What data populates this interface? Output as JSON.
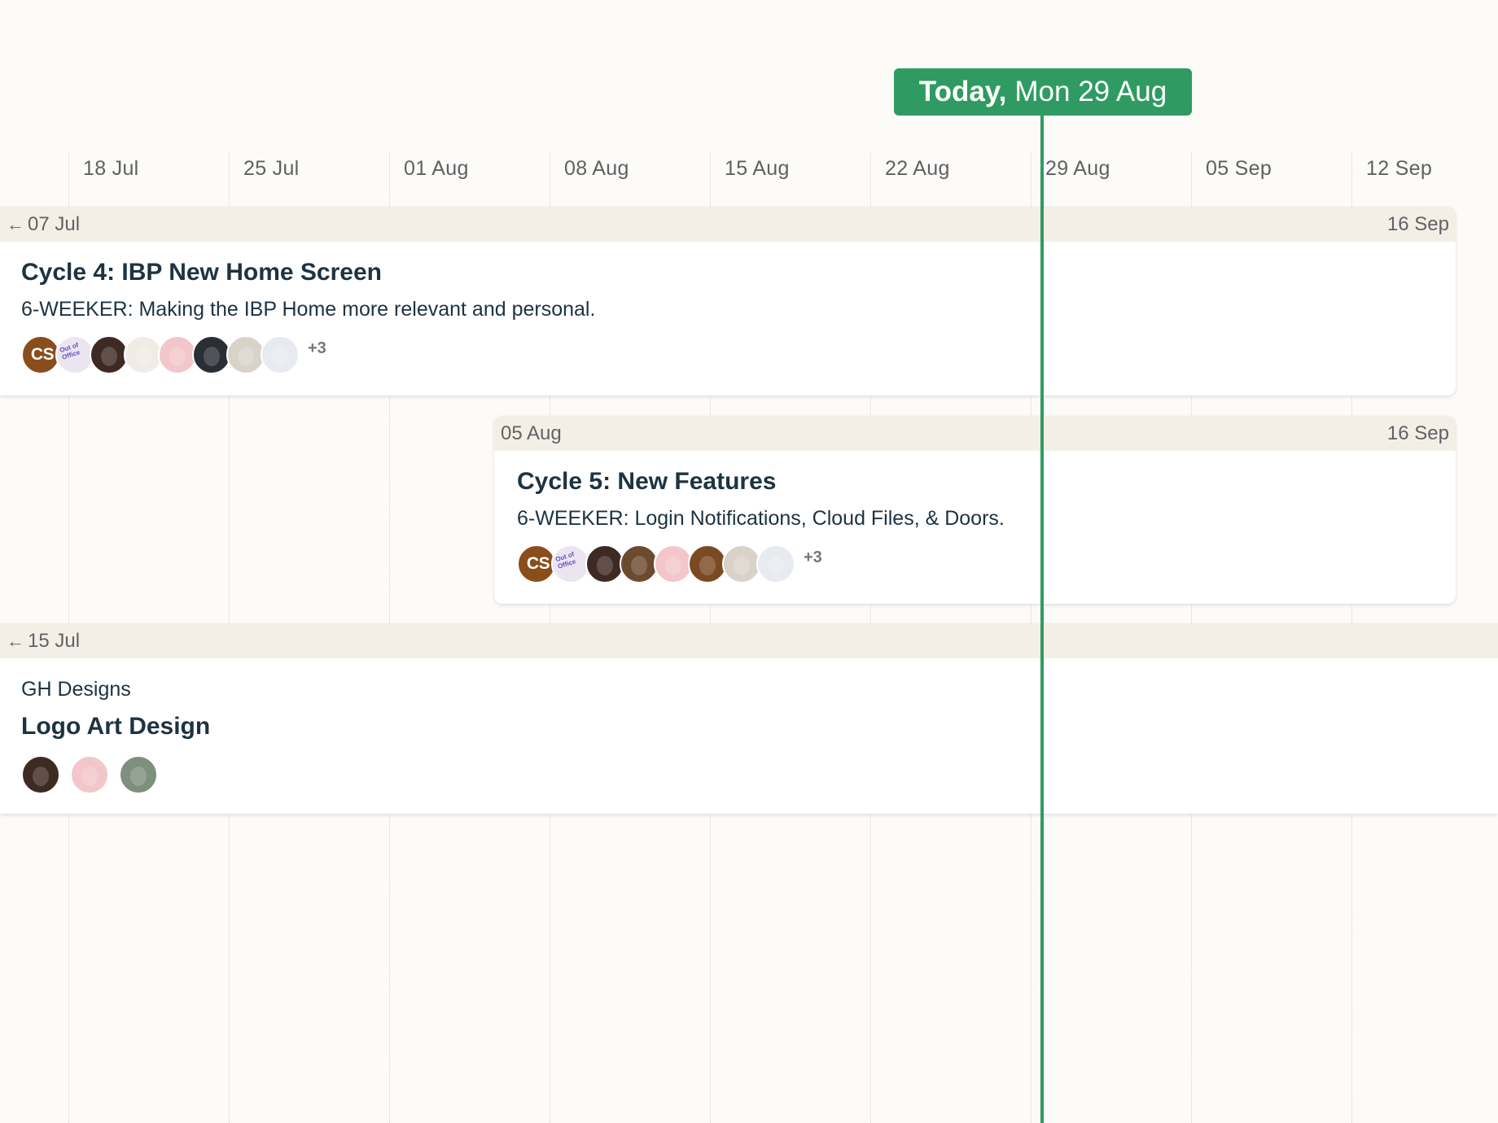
{
  "today": {
    "label": "Today,",
    "date": "Mon 29 Aug"
  },
  "weeks": [
    "18 Jul",
    "25 Jul",
    "01 Aug",
    "08 Aug",
    "15 Aug",
    "22 Aug",
    "29 Aug",
    "05 Sep",
    "12 Sep"
  ],
  "projects": [
    {
      "start": "07 Jul",
      "end": "16 Sep",
      "title": "Cycle 4: IBP New Home Screen",
      "description": "6-WEEKER: Making the IBP Home more relevant and personal.",
      "overflow": "+3",
      "avatars": [
        {
          "type": "initials",
          "initials": "CS",
          "color": "#8a4d1c"
        },
        {
          "type": "sticker",
          "text": "Out of Office",
          "color": "#e9e6ef"
        },
        {
          "type": "photo",
          "color": "#3d2a22"
        },
        {
          "type": "photo",
          "color": "#f1ebe6"
        },
        {
          "type": "photo",
          "color": "#f2c6cb"
        },
        {
          "type": "photo",
          "color": "#2a2f35"
        },
        {
          "type": "photo",
          "color": "#d9d2c8"
        },
        {
          "type": "photo",
          "color": "#e7ebef"
        }
      ]
    },
    {
      "start": "05 Aug",
      "end": "16 Sep",
      "title": "Cycle 5: New Features",
      "description": "6-WEEKER: Login Notifications, Cloud Files, & Doors.",
      "overflow": "+3",
      "avatars": [
        {
          "type": "initials",
          "initials": "CS",
          "color": "#8a4d1c"
        },
        {
          "type": "sticker",
          "text": "Out of Office",
          "color": "#e9e6ef"
        },
        {
          "type": "photo",
          "color": "#3d2a22"
        },
        {
          "type": "photo",
          "color": "#6b4a2e"
        },
        {
          "type": "photo",
          "color": "#f2c6cb"
        },
        {
          "type": "photo",
          "color": "#7a4a23"
        },
        {
          "type": "photo",
          "color": "#d9d2c8"
        },
        {
          "type": "photo",
          "color": "#e7ebef"
        }
      ]
    },
    {
      "start": "15 Jul",
      "client": "GH Designs",
      "title": "Logo Art Design",
      "avatars": [
        {
          "type": "photo",
          "color": "#3d2a22"
        },
        {
          "type": "photo",
          "color": "#f2c6cb"
        },
        {
          "type": "photo",
          "color": "#7d8f7d"
        }
      ]
    }
  ],
  "colors": {
    "accent": "#2f9b62",
    "date_bar": "#f4efe6",
    "background": "#fdfbf8",
    "title_text": "#1d3342"
  }
}
